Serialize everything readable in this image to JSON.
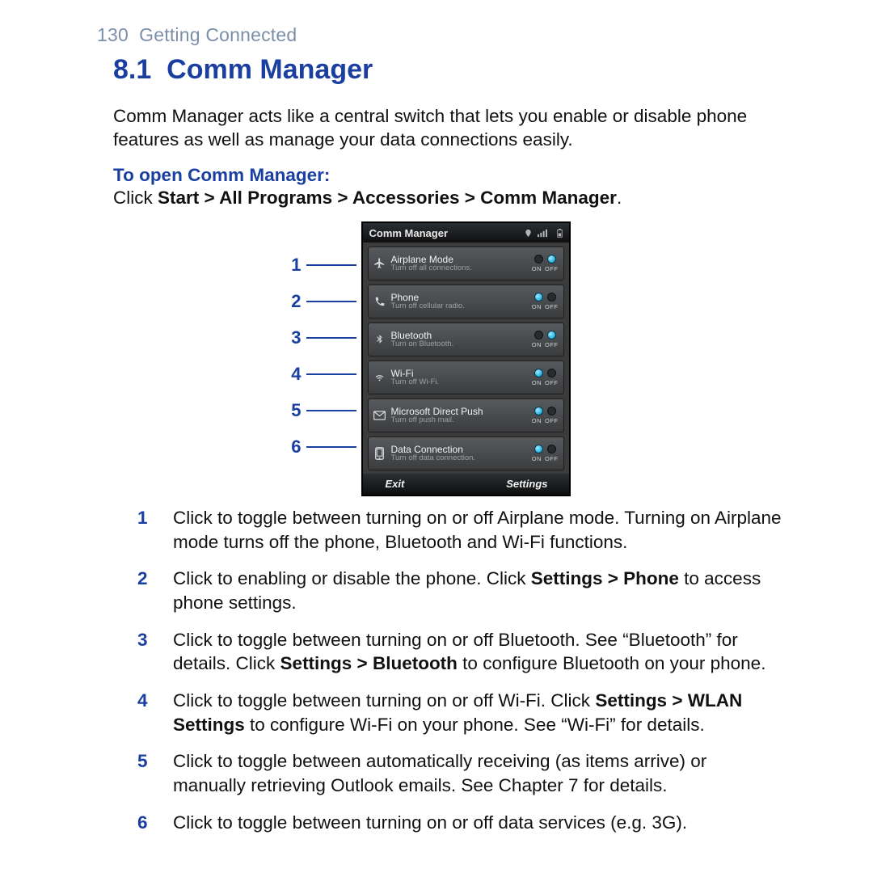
{
  "header": {
    "page_number": "130",
    "chapter": "Getting Connected"
  },
  "section": {
    "number": "8.1",
    "title": "Comm Manager",
    "intro": "Comm Manager acts like a central switch that lets you enable or disable phone features as well as manage your data connections easily.",
    "subheading": "To open Comm Manager:",
    "instruction_prefix": "Click ",
    "instruction_path": "Start > All Programs > Accessories > Comm Manager",
    "instruction_suffix": "."
  },
  "device": {
    "title": "Comm Manager",
    "rows": [
      {
        "label": "Airplane Mode",
        "sub": "Turn off all connections.",
        "state": "off",
        "on_label": "ON",
        "off_label": "OFF"
      },
      {
        "label": "Phone",
        "sub": "Turn off cellular radio.",
        "state": "on",
        "on_label": "ON",
        "off_label": "OFF"
      },
      {
        "label": "Bluetooth",
        "sub": "Turn on Bluetooth.",
        "state": "off",
        "on_label": "ON",
        "off_label": "OFF"
      },
      {
        "label": "Wi-Fi",
        "sub": "Turn off Wi-Fi.",
        "state": "on",
        "on_label": "ON",
        "off_label": "OFF"
      },
      {
        "label": "Microsoft Direct Push",
        "sub": "Turn off push mail.",
        "state": "on",
        "on_label": "ON",
        "off_label": "OFF"
      },
      {
        "label": "Data Connection",
        "sub": "Turn off data connection.",
        "state": "on",
        "on_label": "ON",
        "off_label": "OFF"
      }
    ],
    "footer": {
      "left": "Exit",
      "right": "Settings"
    }
  },
  "callouts": [
    "1",
    "2",
    "3",
    "4",
    "5",
    "6"
  ],
  "explanations": [
    {
      "n": "1",
      "parts": [
        "Click to toggle between turning on or off Airplane mode. Turning on Airplane mode turns off the phone, Bluetooth and Wi-Fi functions."
      ]
    },
    {
      "n": "2",
      "parts": [
        "Click to enabling or disable the phone. Click ",
        "<b>Settings > Phone</b>",
        " to access phone settings."
      ]
    },
    {
      "n": "3",
      "parts": [
        "Click to toggle between turning on or off Bluetooth. See “Bluetooth” for details. Click ",
        "<b>Settings > Bluetooth</b>",
        " to configure Bluetooth on your phone."
      ]
    },
    {
      "n": "4",
      "parts": [
        "Click to toggle between turning on or off Wi-Fi. Click ",
        "<b>Settings > WLAN Settings</b>",
        " to configure Wi-Fi on your phone. See “Wi-Fi” for details."
      ]
    },
    {
      "n": "5",
      "parts": [
        "Click to toggle between automatically receiving (as items arrive) or manually retrieving Outlook emails. See Chapter 7 for details."
      ]
    },
    {
      "n": "6",
      "parts": [
        "Click to toggle between turning on or off data services (e.g. 3G)."
      ]
    }
  ]
}
